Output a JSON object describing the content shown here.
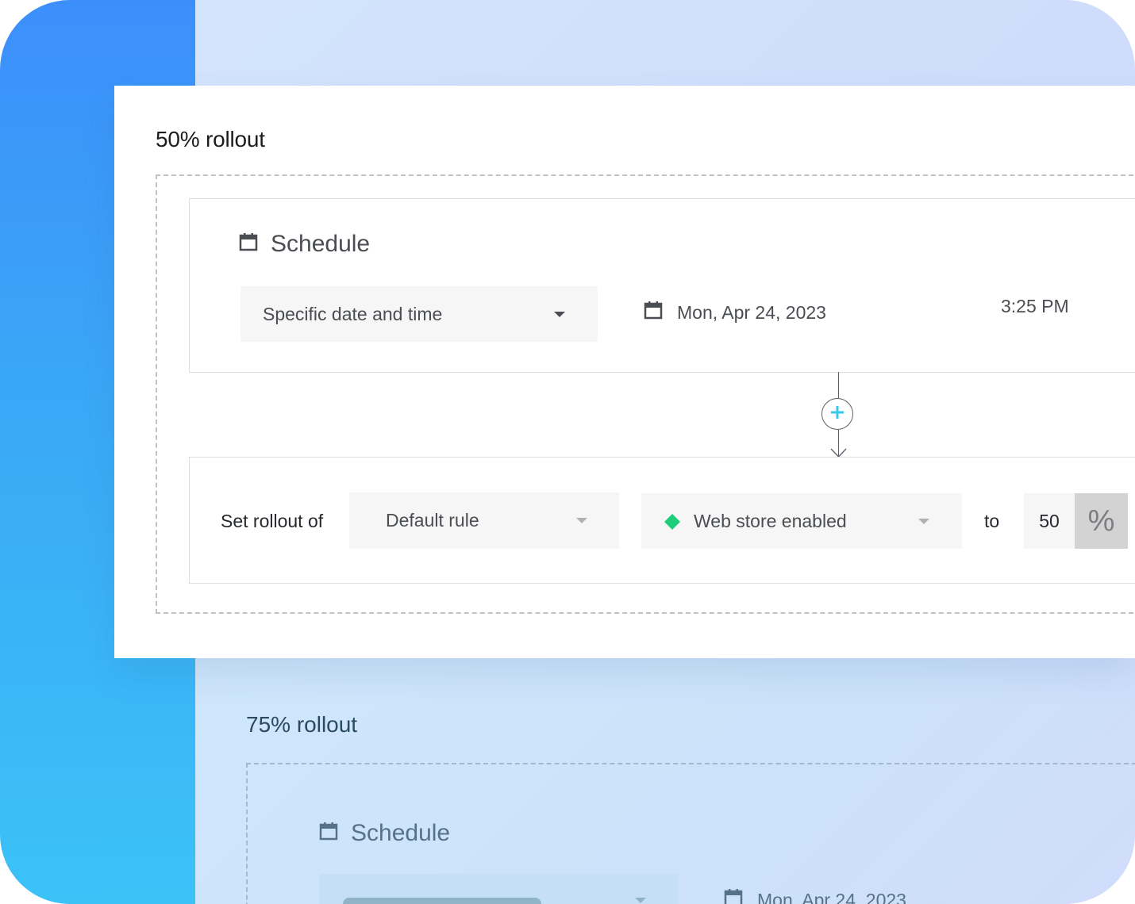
{
  "rollout_50": {
    "title": "50% rollout",
    "schedule": {
      "heading": "Schedule",
      "type_select": "Specific date and time",
      "date": "Mon, Apr 24, 2023",
      "time": "3:25 PM"
    },
    "add_step_icon": "plus-icon",
    "rollout_rule": {
      "prefix": "Set rollout of",
      "rule_select": "Default rule",
      "variation_select": "Web store enabled",
      "variation_color": "#1fce7a",
      "connector": "to",
      "percentage": "50",
      "percent_symbol": "%"
    }
  },
  "rollout_75": {
    "title": "75% rollout",
    "schedule": {
      "heading": "Schedule",
      "date": "Mon, Apr 24, 2023"
    }
  },
  "colors": {
    "accent": "#35c8e8",
    "sidebar_top": "#3c8ffb",
    "sidebar_bottom": "#3bc2f7",
    "background": "#d4e6fd"
  }
}
